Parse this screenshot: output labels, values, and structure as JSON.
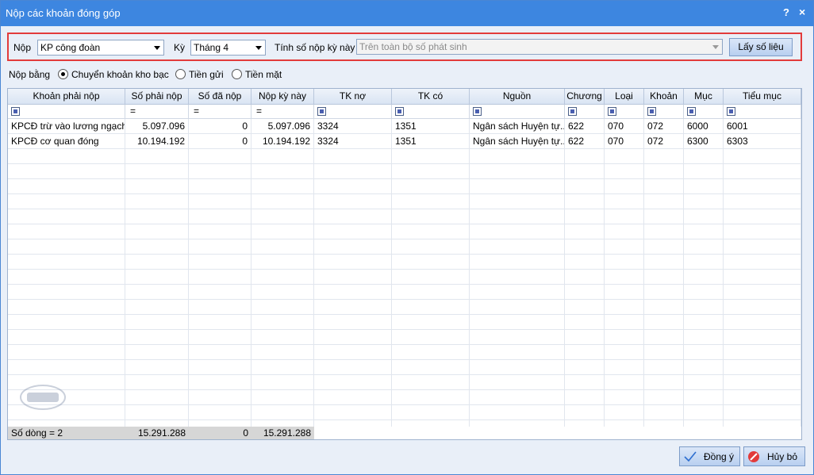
{
  "window": {
    "title": "Nộp các khoản đóng góp",
    "help": "?",
    "close": "×"
  },
  "filters": {
    "nop_label": "Nộp",
    "nop_value": "KP công đoàn",
    "ky_label": "Kỳ",
    "ky_value": "Tháng 4",
    "tinh_label": "Tính số nộp kỳ này",
    "tinh_value": "Trên toàn bộ số phát sinh",
    "get_button": "Lấy số liệu"
  },
  "payment": {
    "label": "Nộp bằng",
    "options": [
      "Chuyển khoản kho bạc",
      "Tiền gửi",
      "Tiền mặt"
    ],
    "selected": "Chuyển khoản kho bạc"
  },
  "table": {
    "columns": [
      "Khoản phải nộp",
      "Số phải nộp",
      "Số đã nộp",
      "Nộp kỳ này",
      "TK nợ",
      "TK có",
      "Nguồn",
      "Chương",
      "Loại",
      "Khoản",
      "Mục",
      "Tiểu mục"
    ],
    "rows": [
      [
        "KPCĐ trừ vào lương ngạch...",
        "5.097.096",
        "0",
        "5.097.096",
        "3324",
        "1351",
        "Ngân sách Huyện tự...",
        "622",
        "070",
        "072",
        "6000",
        "6001"
      ],
      [
        "KPCĐ cơ quan đóng",
        "10.194.192",
        "0",
        "10.194.192",
        "3324",
        "1351",
        "Ngân sách Huyện tự...",
        "622",
        "070",
        "072",
        "6300",
        "6303"
      ]
    ],
    "footer": {
      "count": "Số dòng = 2",
      "so_phai_nop": "15.291.288",
      "so_da_nop": "0",
      "nop_ky_nay": "15.291.288"
    }
  },
  "buttons": {
    "ok": "Đồng ý",
    "cancel": "Hủy bỏ"
  },
  "icons": {
    "filter": "filter-icon",
    "ok": "check-icon",
    "cancel": "cancel-icon"
  },
  "colors": {
    "titlebar": "#3d86e0",
    "highlight": "#e23b3b"
  }
}
